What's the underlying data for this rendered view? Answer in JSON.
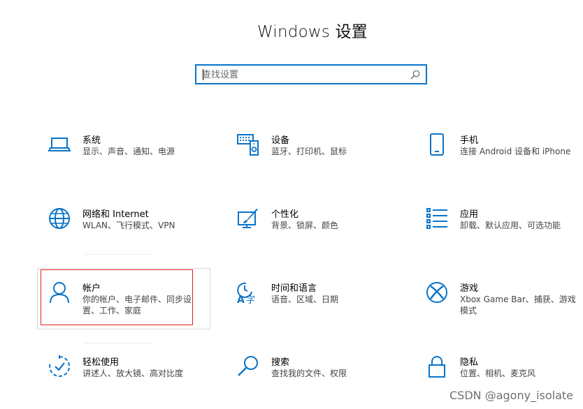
{
  "title": "Windows 设置",
  "search": {
    "placeholder": "查找设置",
    "icon": "search-icon"
  },
  "accent_color": "#0a74c9",
  "highlight_color": "#e02020",
  "tiles": [
    {
      "name": "系统",
      "desc": "显示、声音、通知、电源",
      "icon": "laptop-icon"
    },
    {
      "name": "设备",
      "desc": "蓝牙、打印机、鼠标",
      "icon": "devices-icon"
    },
    {
      "name": "手机",
      "desc": "连接 Android 设备和 iPhone",
      "icon": "phone-icon"
    },
    {
      "name": "网络和 Internet",
      "desc": "WLAN、飞行模式、VPN",
      "icon": "globe-icon"
    },
    {
      "name": "个性化",
      "desc": "背景、锁屏、颜色",
      "icon": "personalization-icon"
    },
    {
      "name": "应用",
      "desc": "卸载、默认应用、可选功能",
      "icon": "apps-list-icon"
    },
    {
      "name": "帐户",
      "desc": "你的帐户、电子邮件、同步设置、工作、家庭",
      "icon": "person-icon"
    },
    {
      "name": "时间和语言",
      "desc": "语音、区域、日期",
      "icon": "time-language-icon"
    },
    {
      "name": "游戏",
      "desc": "Xbox Game Bar、捕获、游戏模式",
      "icon": "xbox-icon"
    },
    {
      "name": "轻松使用",
      "desc": "讲述人、放大镜、高对比度",
      "icon": "ease-of-access-icon"
    },
    {
      "name": "搜索",
      "desc": "查找我的文件、权限",
      "icon": "search-large-icon"
    },
    {
      "name": "隐私",
      "desc": "位置、相机、麦克风",
      "icon": "lock-icon"
    }
  ],
  "watermark": "CSDN @agony_isolate"
}
